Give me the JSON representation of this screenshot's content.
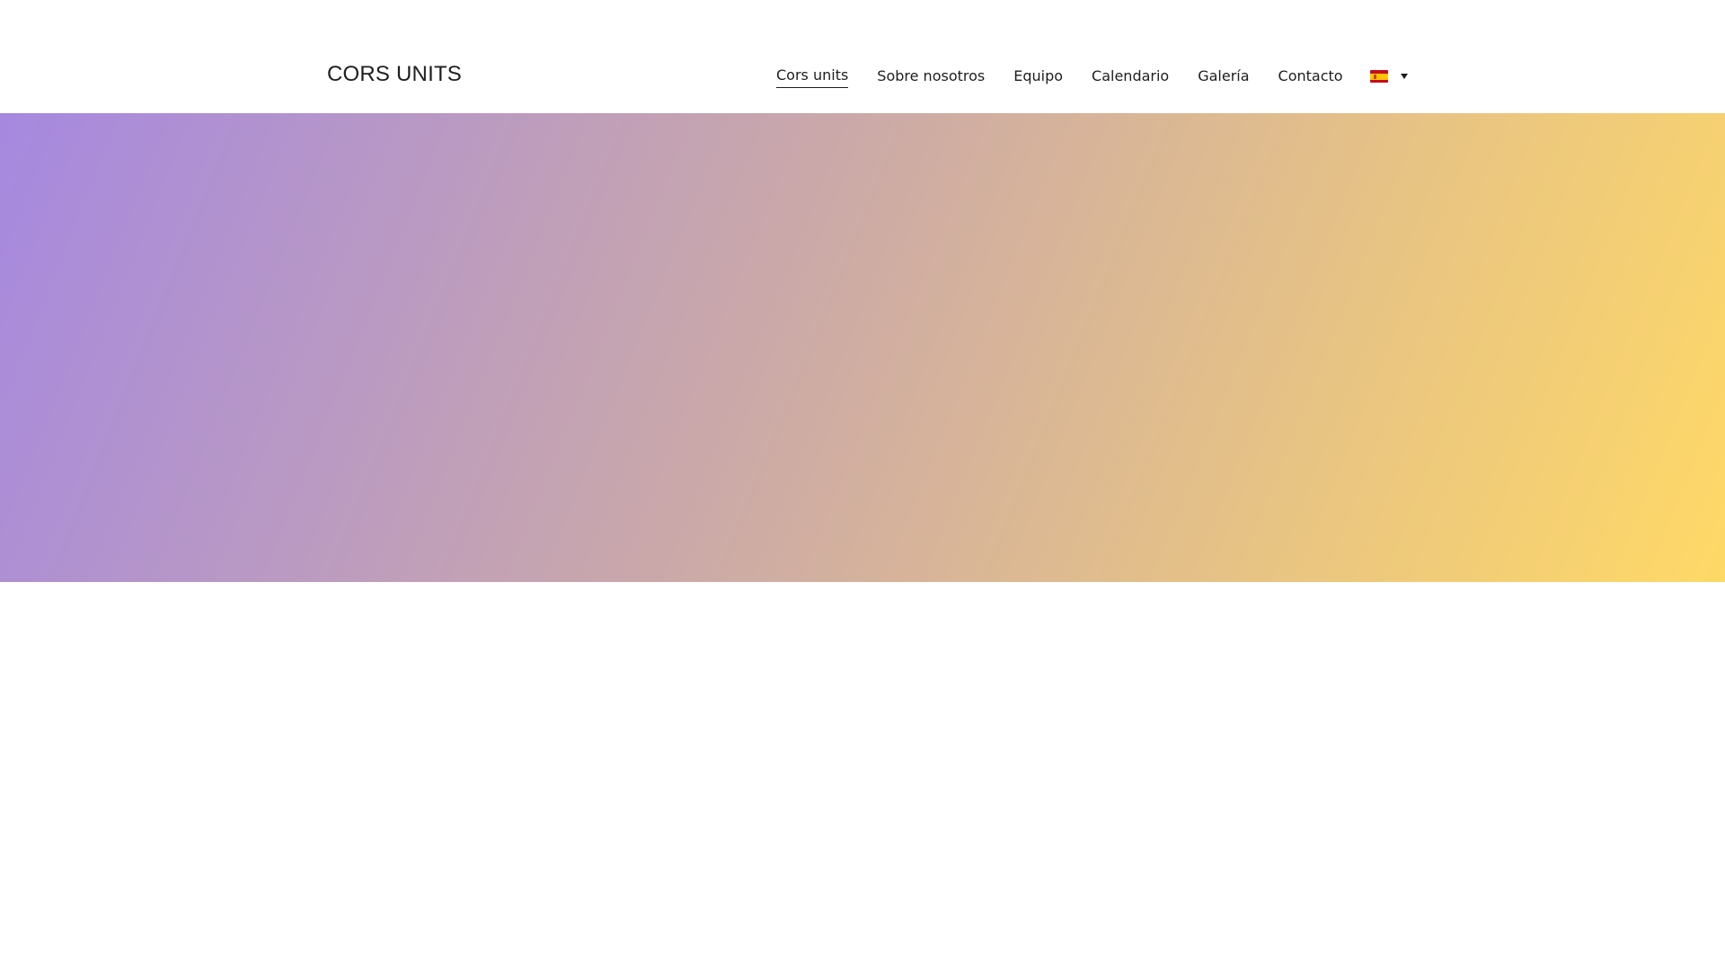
{
  "site": {
    "title": "CORS UNITS"
  },
  "nav": {
    "items": [
      {
        "label": "Cors units",
        "current": true
      },
      {
        "label": "Sobre nosotros"
      },
      {
        "label": "Equipo"
      },
      {
        "label": "Calendario"
      },
      {
        "label": "Galería"
      },
      {
        "label": "Contacto"
      }
    ],
    "language": {
      "icon": "spain-flag-icon",
      "dropdown_icon": "caret-down-icon",
      "flag_colors": [
        "#c60b1e",
        "#ffc400",
        "#c60b1e"
      ]
    }
  },
  "hero": {
    "gradient_start": "#a688e0",
    "gradient_mid": "#cba9a8",
    "gradient_end": "#ffd966"
  }
}
